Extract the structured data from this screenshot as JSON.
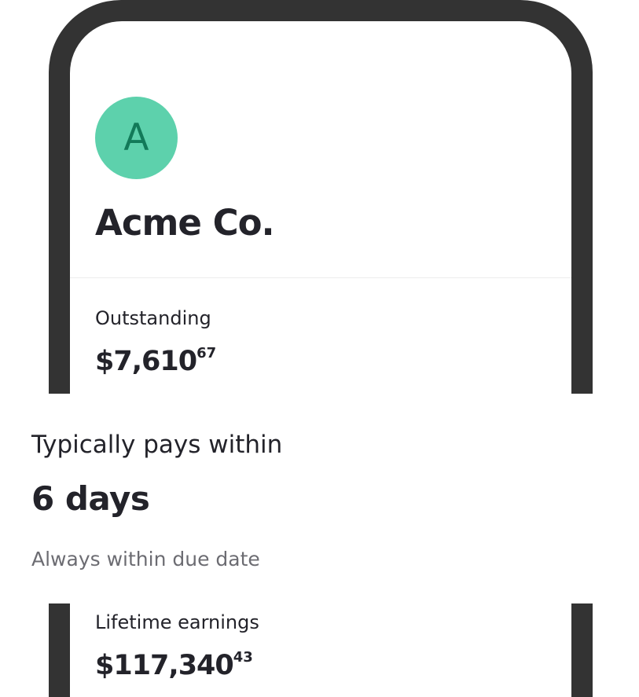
{
  "customer": {
    "avatar_initial": "A",
    "name": "Acme Co."
  },
  "outstanding": {
    "label": "Outstanding",
    "amount_main": "$7,610",
    "amount_cents": "67"
  },
  "payment_behavior": {
    "label": "Typically pays within",
    "value": "6 days",
    "note": "Always within due date"
  },
  "lifetime": {
    "label": "Lifetime earnings",
    "amount_main": "$117,340",
    "amount_cents": "43"
  },
  "colors": {
    "avatar_bg": "#5dd1ac",
    "avatar_text": "#127a59",
    "phone_frame": "#333333",
    "text_primary": "#23232a",
    "text_secondary": "#6c6c72"
  }
}
